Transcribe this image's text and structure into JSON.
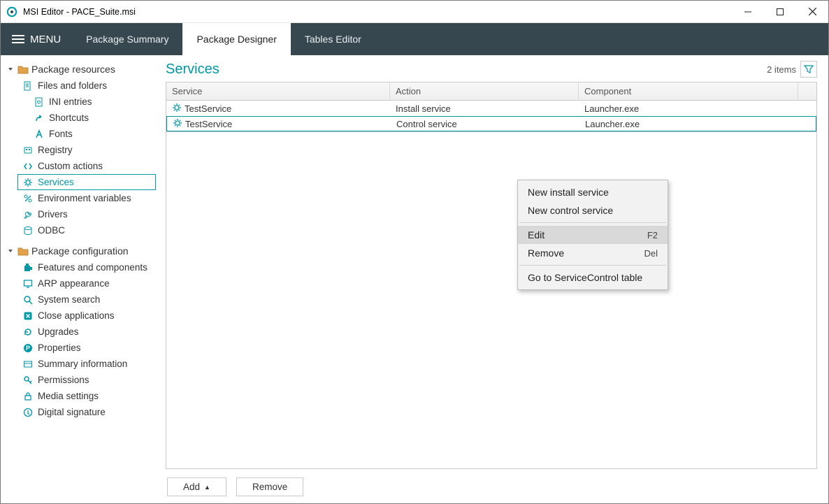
{
  "window": {
    "title": "MSI Editor - PACE_Suite.msi"
  },
  "menubar": {
    "menu_label": "MENU",
    "tabs": [
      {
        "label": "Package Summary"
      },
      {
        "label": "Package Designer"
      },
      {
        "label": "Tables Editor"
      }
    ],
    "active_index": 1
  },
  "sidebar": {
    "groups": [
      {
        "label": "Package resources",
        "items": [
          {
            "icon": "file-icon",
            "label": "Files and folders",
            "level": 1
          },
          {
            "icon": "ini-icon",
            "label": "INI entries",
            "level": 2
          },
          {
            "icon": "shortcut-icon",
            "label": "Shortcuts",
            "level": 2
          },
          {
            "icon": "font-icon",
            "label": "Fonts",
            "level": 2
          },
          {
            "icon": "registry-icon",
            "label": "Registry",
            "level": 1
          },
          {
            "icon": "code-icon",
            "label": "Custom actions",
            "level": 1
          },
          {
            "icon": "gear-icon",
            "label": "Services",
            "level": 1,
            "selected": true
          },
          {
            "icon": "percent-icon",
            "label": "Environment variables",
            "level": 1
          },
          {
            "icon": "wrench-icon",
            "label": "Drivers",
            "level": 1
          },
          {
            "icon": "db-icon",
            "label": "ODBC",
            "level": 1
          }
        ]
      },
      {
        "label": "Package configuration",
        "items": [
          {
            "icon": "puzzle-icon",
            "label": "Features and components",
            "level": 1
          },
          {
            "icon": "monitor-icon",
            "label": "ARP appearance",
            "level": 1
          },
          {
            "icon": "search-icon",
            "label": "System search",
            "level": 1
          },
          {
            "icon": "close-app-icon",
            "label": "Close applications",
            "level": 1
          },
          {
            "icon": "refresh-icon",
            "label": "Upgrades",
            "level": 1
          },
          {
            "icon": "p-icon",
            "label": "Properties",
            "level": 1
          },
          {
            "icon": "card-icon",
            "label": "Summary information",
            "level": 1
          },
          {
            "icon": "key-icon",
            "label": "Permissions",
            "level": 1
          },
          {
            "icon": "lock-icon",
            "label": "Media settings",
            "level": 1
          },
          {
            "icon": "sign-icon",
            "label": "Digital signature",
            "level": 1
          }
        ]
      }
    ]
  },
  "main": {
    "title": "Services",
    "items_count_label": "2 items",
    "columns": [
      {
        "label": "Service"
      },
      {
        "label": "Action"
      },
      {
        "label": "Component"
      }
    ],
    "rows": [
      {
        "service": "TestService",
        "action": "Install service",
        "component": "Launcher.exe",
        "selected": false
      },
      {
        "service": "TestService",
        "action": "Control service",
        "component": "Launcher.exe",
        "selected": true
      }
    ],
    "footer": {
      "add_label": "Add",
      "remove_label": "Remove"
    }
  },
  "context_menu": {
    "items": [
      {
        "label": "New install service"
      },
      {
        "label": "New control service"
      },
      {
        "sep": true
      },
      {
        "label": "Edit",
        "shortcut": "F2",
        "hover": true
      },
      {
        "label": "Remove",
        "shortcut": "Del"
      },
      {
        "sep": true
      },
      {
        "label": "Go to ServiceControl table"
      }
    ]
  }
}
